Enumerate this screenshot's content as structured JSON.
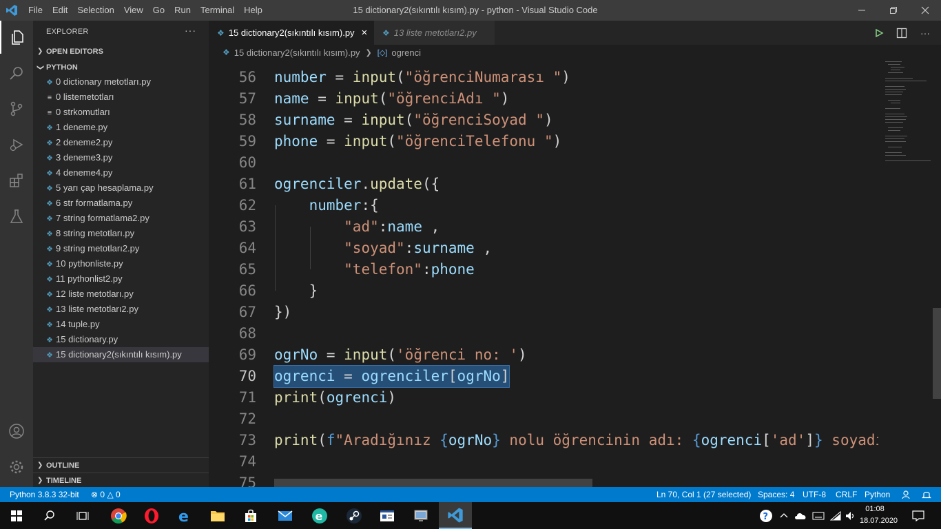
{
  "window": {
    "title": "15 dictionary2(sıkıntılı kısım).py - python - Visual Studio Code",
    "menu": [
      "File",
      "Edit",
      "Selection",
      "View",
      "Go",
      "Run",
      "Terminal",
      "Help"
    ]
  },
  "sidebar": {
    "title": "EXPLORER",
    "more": "···",
    "open_editors": "OPEN EDITORS",
    "folder": "PYTHON",
    "outline": "OUTLINE",
    "timeline": "TIMELINE",
    "files": [
      {
        "name": "0 dictionary metotları.py",
        "type": "py"
      },
      {
        "name": "0 listemetotları",
        "type": "txt"
      },
      {
        "name": "0 strkomutları",
        "type": "txt"
      },
      {
        "name": "1 deneme.py",
        "type": "py"
      },
      {
        "name": "2 deneme2.py",
        "type": "py"
      },
      {
        "name": "3 deneme3.py",
        "type": "py"
      },
      {
        "name": "4 deneme4.py",
        "type": "py"
      },
      {
        "name": "5 yarı çap hesaplama.py",
        "type": "py"
      },
      {
        "name": "6 str formatlama.py",
        "type": "py"
      },
      {
        "name": "7 string formatlama2.py",
        "type": "py"
      },
      {
        "name": "8 string metotları.py",
        "type": "py"
      },
      {
        "name": "9 string metotları2.py",
        "type": "py"
      },
      {
        "name": "10 pythonliste.py",
        "type": "py"
      },
      {
        "name": "11 pythonlist2.py",
        "type": "py"
      },
      {
        "name": "12 liste metotları.py",
        "type": "py"
      },
      {
        "name": "13 liste metotları2.py",
        "type": "py"
      },
      {
        "name": "14 tuple.py",
        "type": "py"
      },
      {
        "name": "15 dictionary.py",
        "type": "py"
      },
      {
        "name": "15 dictionary2(sıkıntılı kısım).py",
        "type": "py",
        "selected": true
      }
    ]
  },
  "tabs": [
    {
      "label": "15 dictionary2(sıkıntılı kısım).py",
      "active": true,
      "close": "×"
    },
    {
      "label": "13 liste metotları2.py",
      "active": false
    }
  ],
  "breadcrumb": {
    "file": "15 dictionary2(sıkıntılı kısım).py",
    "symbol": "ogrenci"
  },
  "editor": {
    "lines": [
      {
        "n": "56",
        "tokens": [
          [
            "v",
            "number"
          ],
          [
            "p",
            " = "
          ],
          [
            "f",
            "input"
          ],
          [
            "p",
            "("
          ],
          [
            "s",
            "\"öğrenciNumarası \""
          ],
          [
            "p",
            ")"
          ]
        ]
      },
      {
        "n": "57",
        "tokens": [
          [
            "v",
            "name"
          ],
          [
            "p",
            " = "
          ],
          [
            "f",
            "input"
          ],
          [
            "p",
            "("
          ],
          [
            "s",
            "\"öğrenciAdı \""
          ],
          [
            "p",
            ")"
          ]
        ]
      },
      {
        "n": "58",
        "tokens": [
          [
            "v",
            "surname"
          ],
          [
            "p",
            " = "
          ],
          [
            "f",
            "input"
          ],
          [
            "p",
            "("
          ],
          [
            "s",
            "\"öğrenciSoyad \""
          ],
          [
            "p",
            ")"
          ]
        ]
      },
      {
        "n": "59",
        "tokens": [
          [
            "v",
            "phone"
          ],
          [
            "p",
            " = "
          ],
          [
            "f",
            "input"
          ],
          [
            "p",
            "("
          ],
          [
            "s",
            "\"öğrenciTelefonu \""
          ],
          [
            "p",
            ")"
          ]
        ]
      },
      {
        "n": "60",
        "tokens": []
      },
      {
        "n": "61",
        "tokens": [
          [
            "v",
            "ogrenciler"
          ],
          [
            "p",
            "."
          ],
          [
            "f",
            "update"
          ],
          [
            "p",
            "({"
          ]
        ]
      },
      {
        "n": "62",
        "tokens": [
          [
            "p",
            "    "
          ],
          [
            "v",
            "number"
          ],
          [
            "p",
            ":{"
          ]
        ]
      },
      {
        "n": "63",
        "tokens": [
          [
            "p",
            "        "
          ],
          [
            "s",
            "\"ad\""
          ],
          [
            "p",
            ":"
          ],
          [
            "v",
            "name"
          ],
          [
            "p",
            " ,"
          ]
        ]
      },
      {
        "n": "64",
        "tokens": [
          [
            "p",
            "        "
          ],
          [
            "s",
            "\"soyad\""
          ],
          [
            "p",
            ":"
          ],
          [
            "v",
            "surname"
          ],
          [
            "p",
            " ,"
          ]
        ]
      },
      {
        "n": "65",
        "tokens": [
          [
            "p",
            "        "
          ],
          [
            "s",
            "\"telefon\""
          ],
          [
            "p",
            ":"
          ],
          [
            "v",
            "phone"
          ]
        ]
      },
      {
        "n": "66",
        "tokens": [
          [
            "p",
            "    }"
          ]
        ]
      },
      {
        "n": "67",
        "tokens": [
          [
            "p",
            "})"
          ]
        ]
      },
      {
        "n": "68",
        "tokens": []
      },
      {
        "n": "69",
        "tokens": [
          [
            "v",
            "ogrNo"
          ],
          [
            "p",
            " = "
          ],
          [
            "f",
            "input"
          ],
          [
            "p",
            "("
          ],
          [
            "s",
            "'öğrenci no: '"
          ],
          [
            "p",
            ")"
          ]
        ]
      },
      {
        "n": "70",
        "selected": true,
        "tokens": [
          [
            "v",
            "ogrenci"
          ],
          [
            "p",
            " = "
          ],
          [
            "v",
            "ogrenciler"
          ],
          [
            "p",
            "["
          ],
          [
            "v",
            "ogrNo"
          ],
          [
            "p",
            "]"
          ]
        ]
      },
      {
        "n": "71",
        "tokens": [
          [
            "f",
            "print"
          ],
          [
            "p",
            "("
          ],
          [
            "v",
            "ogrenci"
          ],
          [
            "p",
            ")"
          ]
        ]
      },
      {
        "n": "72",
        "tokens": []
      },
      {
        "n": "73",
        "tokens": [
          [
            "f",
            "print"
          ],
          [
            "p",
            "("
          ],
          [
            "b",
            "f"
          ],
          [
            "s",
            "\"Aradığınız "
          ],
          [
            "b",
            "{"
          ],
          [
            "v",
            "ogrNo"
          ],
          [
            "b",
            "}"
          ],
          [
            "s",
            " nolu öğrencinin adı: "
          ],
          [
            "b",
            "{"
          ],
          [
            "v",
            "ogrenci"
          ],
          [
            "p",
            "["
          ],
          [
            "s",
            "'ad'"
          ],
          [
            "p",
            "]"
          ],
          [
            "b",
            "}"
          ],
          [
            "s",
            " soyadı"
          ]
        ]
      },
      {
        "n": "74",
        "tokens": []
      },
      {
        "n": "75",
        "tokens": []
      }
    ]
  },
  "statusbar": {
    "python": "Python 3.8.3 32-bit",
    "errors": "0",
    "warnings": "0",
    "position": "Ln 70, Col 1 (27 selected)",
    "spaces": "Spaces: 4",
    "encoding": "UTF-8",
    "eol": "CRLF",
    "language": "Python"
  },
  "taskbar": {
    "time": "01:08",
    "date": "18.07.2020"
  },
  "colors": {
    "accent": "#007acc",
    "titlebar": "#3c3c3c",
    "sidebar": "#252526",
    "editor": "#1e1e1e"
  }
}
